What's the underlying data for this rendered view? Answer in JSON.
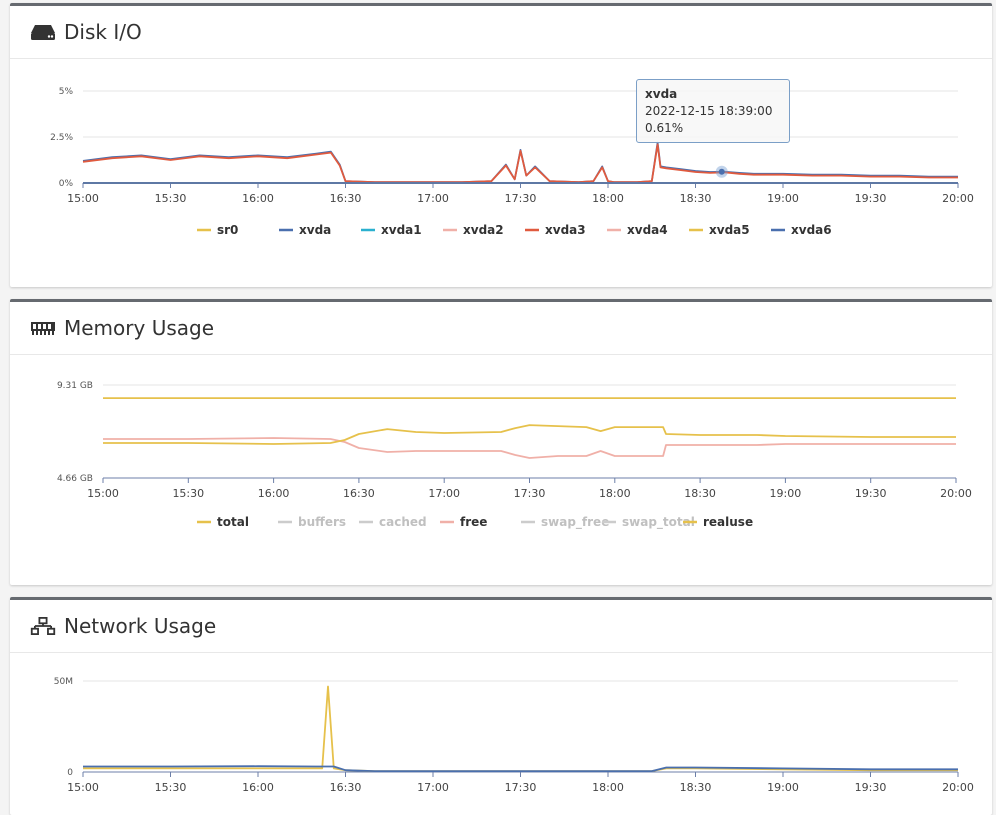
{
  "panels": [
    {
      "title": "Disk I/O",
      "icon": "hard-drive-icon"
    },
    {
      "title": "Memory Usage",
      "icon": "memory-chip-icon"
    },
    {
      "title": "Network Usage",
      "icon": "network-icon"
    }
  ],
  "tooltip": {
    "series": "xvda",
    "time": "2022-12-15 18:39:00",
    "value": "0.61%"
  },
  "colors": {
    "yellow": "#e6c14b",
    "blue": "#4a6fae",
    "cyan": "#2ab0cf",
    "pink": "#f0b0a8",
    "red": "#e05a3e",
    "grey": "#c8c8c8"
  },
  "chart_data": [
    {
      "type": "line",
      "title": "",
      "xlabel": "",
      "ylabel": "",
      "x_ticks": [
        "15:00",
        "15:30",
        "16:00",
        "16:30",
        "17:00",
        "17:30",
        "18:00",
        "18:30",
        "19:00",
        "19:30",
        "20:00"
      ],
      "y_ticks": [
        "0%",
        "2.5%",
        "5%"
      ],
      "ylim": [
        0,
        5
      ],
      "grid": "horizontal",
      "legend_position": "bottom-center",
      "x": [
        "15:00",
        "15:10",
        "15:20",
        "15:30",
        "15:40",
        "15:50",
        "16:00",
        "16:10",
        "16:20",
        "16:25",
        "16:28",
        "16:30",
        "16:40",
        "16:50",
        "17:00",
        "17:10",
        "17:20",
        "17:25",
        "17:28",
        "17:30",
        "17:32",
        "17:35",
        "17:40",
        "17:50",
        "17:55",
        "17:58",
        "18:00",
        "18:02",
        "18:05",
        "18:10",
        "18:15",
        "18:17",
        "18:18",
        "18:20",
        "18:25",
        "18:30",
        "18:35",
        "18:40",
        "18:45",
        "18:50",
        "19:00",
        "19:10",
        "19:20",
        "19:30",
        "19:40",
        "19:50",
        "20:00"
      ],
      "series": [
        {
          "name": "sr0",
          "color": "#e6c14b",
          "values": [
            0,
            0,
            0,
            0,
            0,
            0,
            0,
            0,
            0,
            0,
            0,
            0,
            0,
            0,
            0,
            0,
            0,
            0,
            0,
            0,
            0,
            0,
            0,
            0,
            0,
            0,
            0,
            0,
            0,
            0,
            0,
            0,
            0,
            0,
            0,
            0,
            0,
            0,
            0,
            0,
            0,
            0,
            0,
            0,
            0,
            0,
            0
          ]
        },
        {
          "name": "xvda",
          "color": "#4a6fae",
          "values": [
            1.2,
            1.4,
            1.5,
            1.3,
            1.5,
            1.4,
            1.5,
            1.4,
            1.6,
            1.7,
            1.0,
            0.1,
            0.05,
            0.05,
            0.05,
            0.05,
            0.1,
            1.0,
            0.2,
            1.8,
            0.4,
            0.9,
            0.1,
            0.05,
            0.1,
            0.9,
            0.1,
            0.05,
            0.05,
            0.05,
            0.1,
            2.2,
            0.9,
            0.85,
            0.75,
            0.65,
            0.6,
            0.61,
            0.55,
            0.5,
            0.5,
            0.45,
            0.45,
            0.4,
            0.4,
            0.35,
            0.35
          ]
        },
        {
          "name": "xvda1",
          "color": "#2ab0cf",
          "values": [
            0,
            0,
            0,
            0,
            0,
            0,
            0,
            0,
            0,
            0,
            0,
            0,
            0,
            0,
            0,
            0,
            0,
            0,
            0,
            0,
            0,
            0,
            0,
            0,
            0,
            0,
            0,
            0,
            0,
            0,
            0,
            0,
            0,
            0,
            0,
            0,
            0,
            0,
            0,
            0,
            0,
            0,
            0,
            0,
            0,
            0,
            0
          ]
        },
        {
          "name": "xvda2",
          "color": "#f0b0a8",
          "values": [
            0,
            0,
            0,
            0,
            0,
            0,
            0,
            0,
            0,
            0,
            0,
            0,
            0,
            0,
            0,
            0,
            0,
            0,
            0,
            0,
            0,
            0,
            0,
            0,
            0,
            0,
            0,
            0,
            0,
            0,
            0,
            0,
            0,
            0,
            0,
            0,
            0,
            0,
            0,
            0,
            0,
            0,
            0,
            0,
            0,
            0,
            0
          ]
        },
        {
          "name": "xvda3",
          "color": "#e05a3e",
          "values": [
            1.15,
            1.35,
            1.45,
            1.25,
            1.45,
            1.35,
            1.45,
            1.35,
            1.55,
            1.65,
            0.95,
            0.1,
            0.05,
            0.05,
            0.05,
            0.05,
            0.1,
            0.95,
            0.2,
            1.75,
            0.4,
            0.85,
            0.1,
            0.05,
            0.1,
            0.85,
            0.1,
            0.05,
            0.05,
            0.05,
            0.1,
            2.1,
            0.85,
            0.8,
            0.7,
            0.6,
            0.55,
            0.58,
            0.5,
            0.45,
            0.45,
            0.4,
            0.4,
            0.35,
            0.35,
            0.3,
            0.3
          ]
        },
        {
          "name": "xvda4",
          "color": "#f0b0a8",
          "values": [
            0,
            0,
            0,
            0,
            0,
            0,
            0,
            0,
            0,
            0,
            0,
            0,
            0,
            0,
            0,
            0,
            0,
            0,
            0,
            0,
            0,
            0,
            0,
            0,
            0,
            0,
            0,
            0,
            0,
            0,
            0,
            0,
            0,
            0,
            0,
            0,
            0,
            0,
            0,
            0,
            0,
            0,
            0,
            0,
            0,
            0,
            0
          ]
        },
        {
          "name": "xvda5",
          "color": "#e6c14b",
          "values": [
            0,
            0,
            0,
            0,
            0,
            0,
            0,
            0,
            0,
            0,
            0,
            0,
            0,
            0,
            0,
            0,
            0,
            0,
            0,
            0,
            0,
            0,
            0,
            0,
            0,
            0,
            0,
            0,
            0,
            0,
            0,
            0,
            0,
            0,
            0,
            0,
            0,
            0,
            0,
            0,
            0,
            0,
            0,
            0,
            0,
            0,
            0
          ]
        },
        {
          "name": "xvda6",
          "color": "#4a6fae",
          "values": [
            0,
            0,
            0,
            0,
            0,
            0,
            0,
            0,
            0,
            0,
            0,
            0,
            0,
            0,
            0,
            0,
            0,
            0,
            0,
            0,
            0,
            0,
            0,
            0,
            0,
            0,
            0,
            0,
            0,
            0,
            0,
            0,
            0,
            0,
            0,
            0,
            0,
            0,
            0,
            0,
            0,
            0,
            0,
            0,
            0,
            0,
            0
          ]
        }
      ],
      "legend_inactive": []
    },
    {
      "type": "line",
      "title": "",
      "xlabel": "",
      "ylabel": "",
      "x_ticks": [
        "15:00",
        "15:30",
        "16:00",
        "16:30",
        "17:00",
        "17:30",
        "18:00",
        "18:30",
        "19:00",
        "19:30",
        "20:00"
      ],
      "y_ticks": [
        "4.66 GB",
        "9.31 GB"
      ],
      "ylim": [
        0,
        9.31
      ],
      "grid": "horizontal",
      "legend_position": "bottom-center",
      "x": [
        "15:00",
        "15:30",
        "16:00",
        "16:20",
        "16:25",
        "16:30",
        "16:40",
        "16:50",
        "17:00",
        "17:20",
        "17:25",
        "17:30",
        "17:40",
        "17:50",
        "17:55",
        "18:00",
        "18:10",
        "18:17",
        "18:18",
        "18:30",
        "18:50",
        "19:00",
        "19:30",
        "20:00"
      ],
      "series": [
        {
          "name": "total",
          "color": "#e6c14b",
          "values": [
            8.0,
            8.0,
            8.0,
            8.0,
            8.0,
            8.0,
            8.0,
            8.0,
            8.0,
            8.0,
            8.0,
            8.0,
            8.0,
            8.0,
            8.0,
            8.0,
            8.0,
            8.0,
            8.0,
            8.0,
            8.0,
            8.0,
            8.0,
            8.0
          ]
        },
        {
          "name": "buffers",
          "color": "#c8c8c8",
          "values": []
        },
        {
          "name": "cached",
          "color": "#c8c8c8",
          "values": []
        },
        {
          "name": "free",
          "color": "#f0b0a8",
          "values": [
            3.9,
            3.9,
            4.0,
            3.9,
            3.6,
            3.0,
            2.6,
            2.7,
            2.7,
            2.7,
            2.3,
            2.0,
            2.2,
            2.2,
            2.7,
            2.2,
            2.2,
            2.2,
            3.3,
            3.3,
            3.3,
            3.4,
            3.4,
            3.4
          ]
        },
        {
          "name": "swap_free",
          "color": "#c8c8c8",
          "values": []
        },
        {
          "name": "swap_total",
          "color": "#c8c8c8",
          "values": []
        },
        {
          "name": "realuse",
          "color": "#e6c14b",
          "values": [
            3.5,
            3.5,
            3.4,
            3.5,
            3.8,
            4.4,
            4.9,
            4.6,
            4.5,
            4.6,
            5.0,
            5.3,
            5.2,
            5.1,
            4.7,
            5.1,
            5.1,
            5.1,
            4.4,
            4.3,
            4.3,
            4.2,
            4.1,
            4.1
          ]
        }
      ],
      "legend_inactive": [
        "buffers",
        "cached",
        "swap_free",
        "swap_total"
      ]
    },
    {
      "type": "line",
      "title": "",
      "xlabel": "",
      "ylabel": "",
      "x_ticks": [
        "15:00",
        "15:30",
        "16:00",
        "16:30",
        "17:00",
        "17:30",
        "18:00",
        "18:30",
        "19:00",
        "19:30",
        "20:00"
      ],
      "y_ticks": [
        "0",
        "50M"
      ],
      "ylim": [
        0,
        50
      ],
      "grid": "horizontal",
      "x": [
        "15:00",
        "15:30",
        "16:00",
        "16:20",
        "16:22",
        "16:24",
        "16:26",
        "16:30",
        "16:40",
        "17:00",
        "17:30",
        "18:00",
        "18:15",
        "18:20",
        "18:30",
        "19:00",
        "19:30",
        "20:00"
      ],
      "series": [
        {
          "name": "",
          "color": "#e6c14b",
          "values": [
            2,
            2,
            2,
            2,
            2,
            47,
            2,
            1,
            0.5,
            0.5,
            0.5,
            0.5,
            0.5,
            2,
            2,
            1.5,
            1,
            1
          ]
        },
        {
          "name": "",
          "color": "#4a6fae",
          "values": [
            3,
            3,
            3.2,
            3,
            3,
            3,
            3,
            1,
            0.5,
            0.5,
            0.5,
            0.5,
            0.5,
            2.5,
            2.5,
            2,
            1.5,
            1.5
          ]
        }
      ],
      "legend_inactive": []
    }
  ]
}
